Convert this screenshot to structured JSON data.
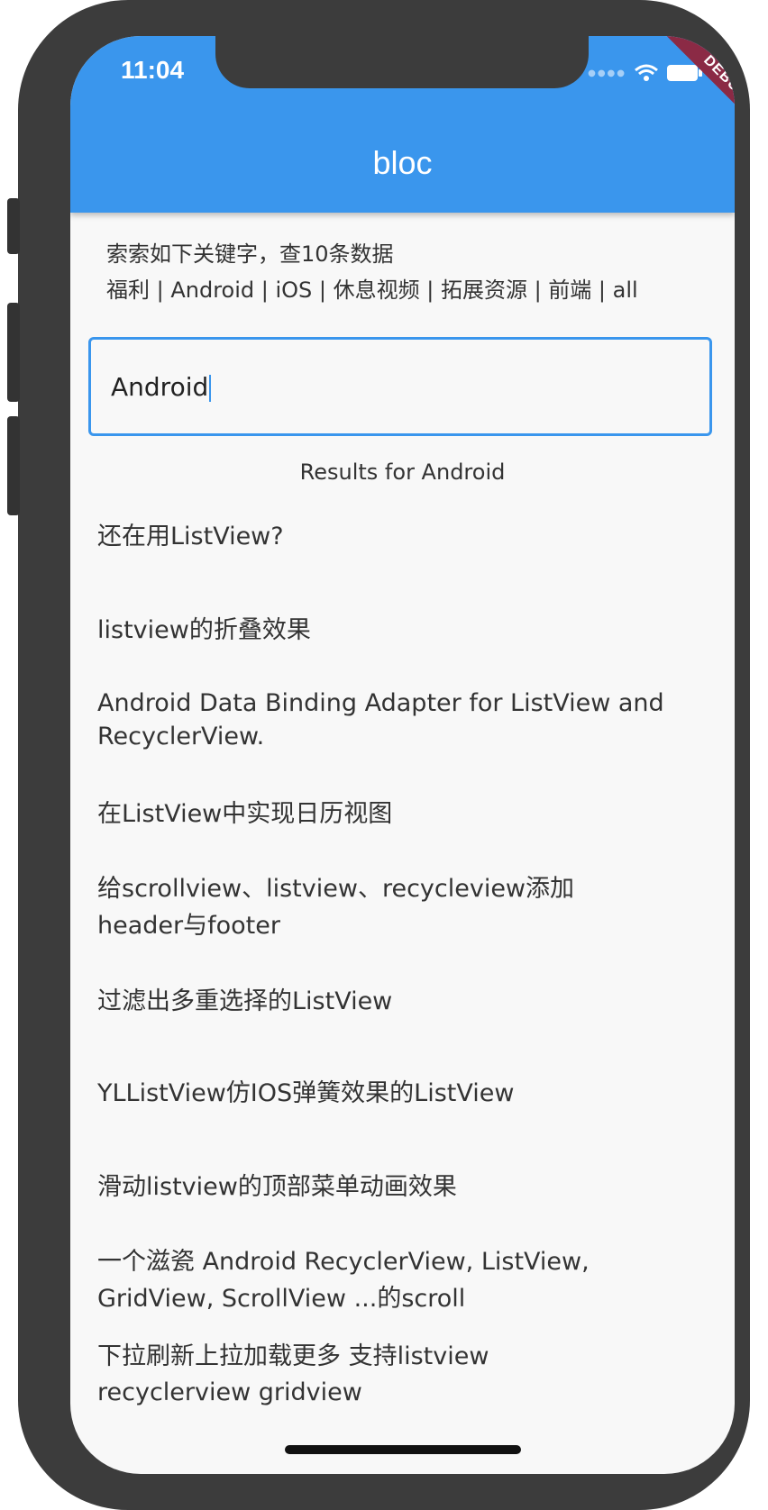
{
  "status_bar": {
    "time": "11:04",
    "icons": [
      "wifi-icon",
      "battery-icon"
    ]
  },
  "appbar": {
    "title": "bloc",
    "debug_banner": "DEBUG"
  },
  "hint": {
    "line1": "索索如下关键字，查10条数据",
    "line2": "福利 | Android | iOS | 休息视频 | 拓展资源 | 前端 | all"
  },
  "search": {
    "value": "Android"
  },
  "results_label": "Results for Android",
  "results": [
    {
      "title": "还在用ListView?"
    },
    {
      "title": "listview的折叠效果"
    },
    {
      "title": "Android Data Binding Adapter for ListView and RecyclerView."
    },
    {
      "title": "在ListView中实现日历视图"
    },
    {
      "title": "给scrollview、listview、recycleview添加header与footer"
    },
    {
      "title": "过滤出多重选择的ListView"
    },
    {
      "title": "YLListView仿IOS弹簧效果的ListView"
    },
    {
      "title": "滑动listview的顶部菜单动画效果"
    },
    {
      "title": "一个滋瓷 Android RecyclerView, ListView, GridView, ScrollView ...的scroll"
    },
    {
      "title": "下拉刷新上拉加载更多 支持listview recyclerview gridview"
    }
  ],
  "colors": {
    "appbar": "#3a96ed",
    "accent": "#3a96ed",
    "debug_banner": "#8b2a45",
    "frame": "#3c3c3c",
    "background": "#f8f8f8",
    "text": "#333333"
  }
}
